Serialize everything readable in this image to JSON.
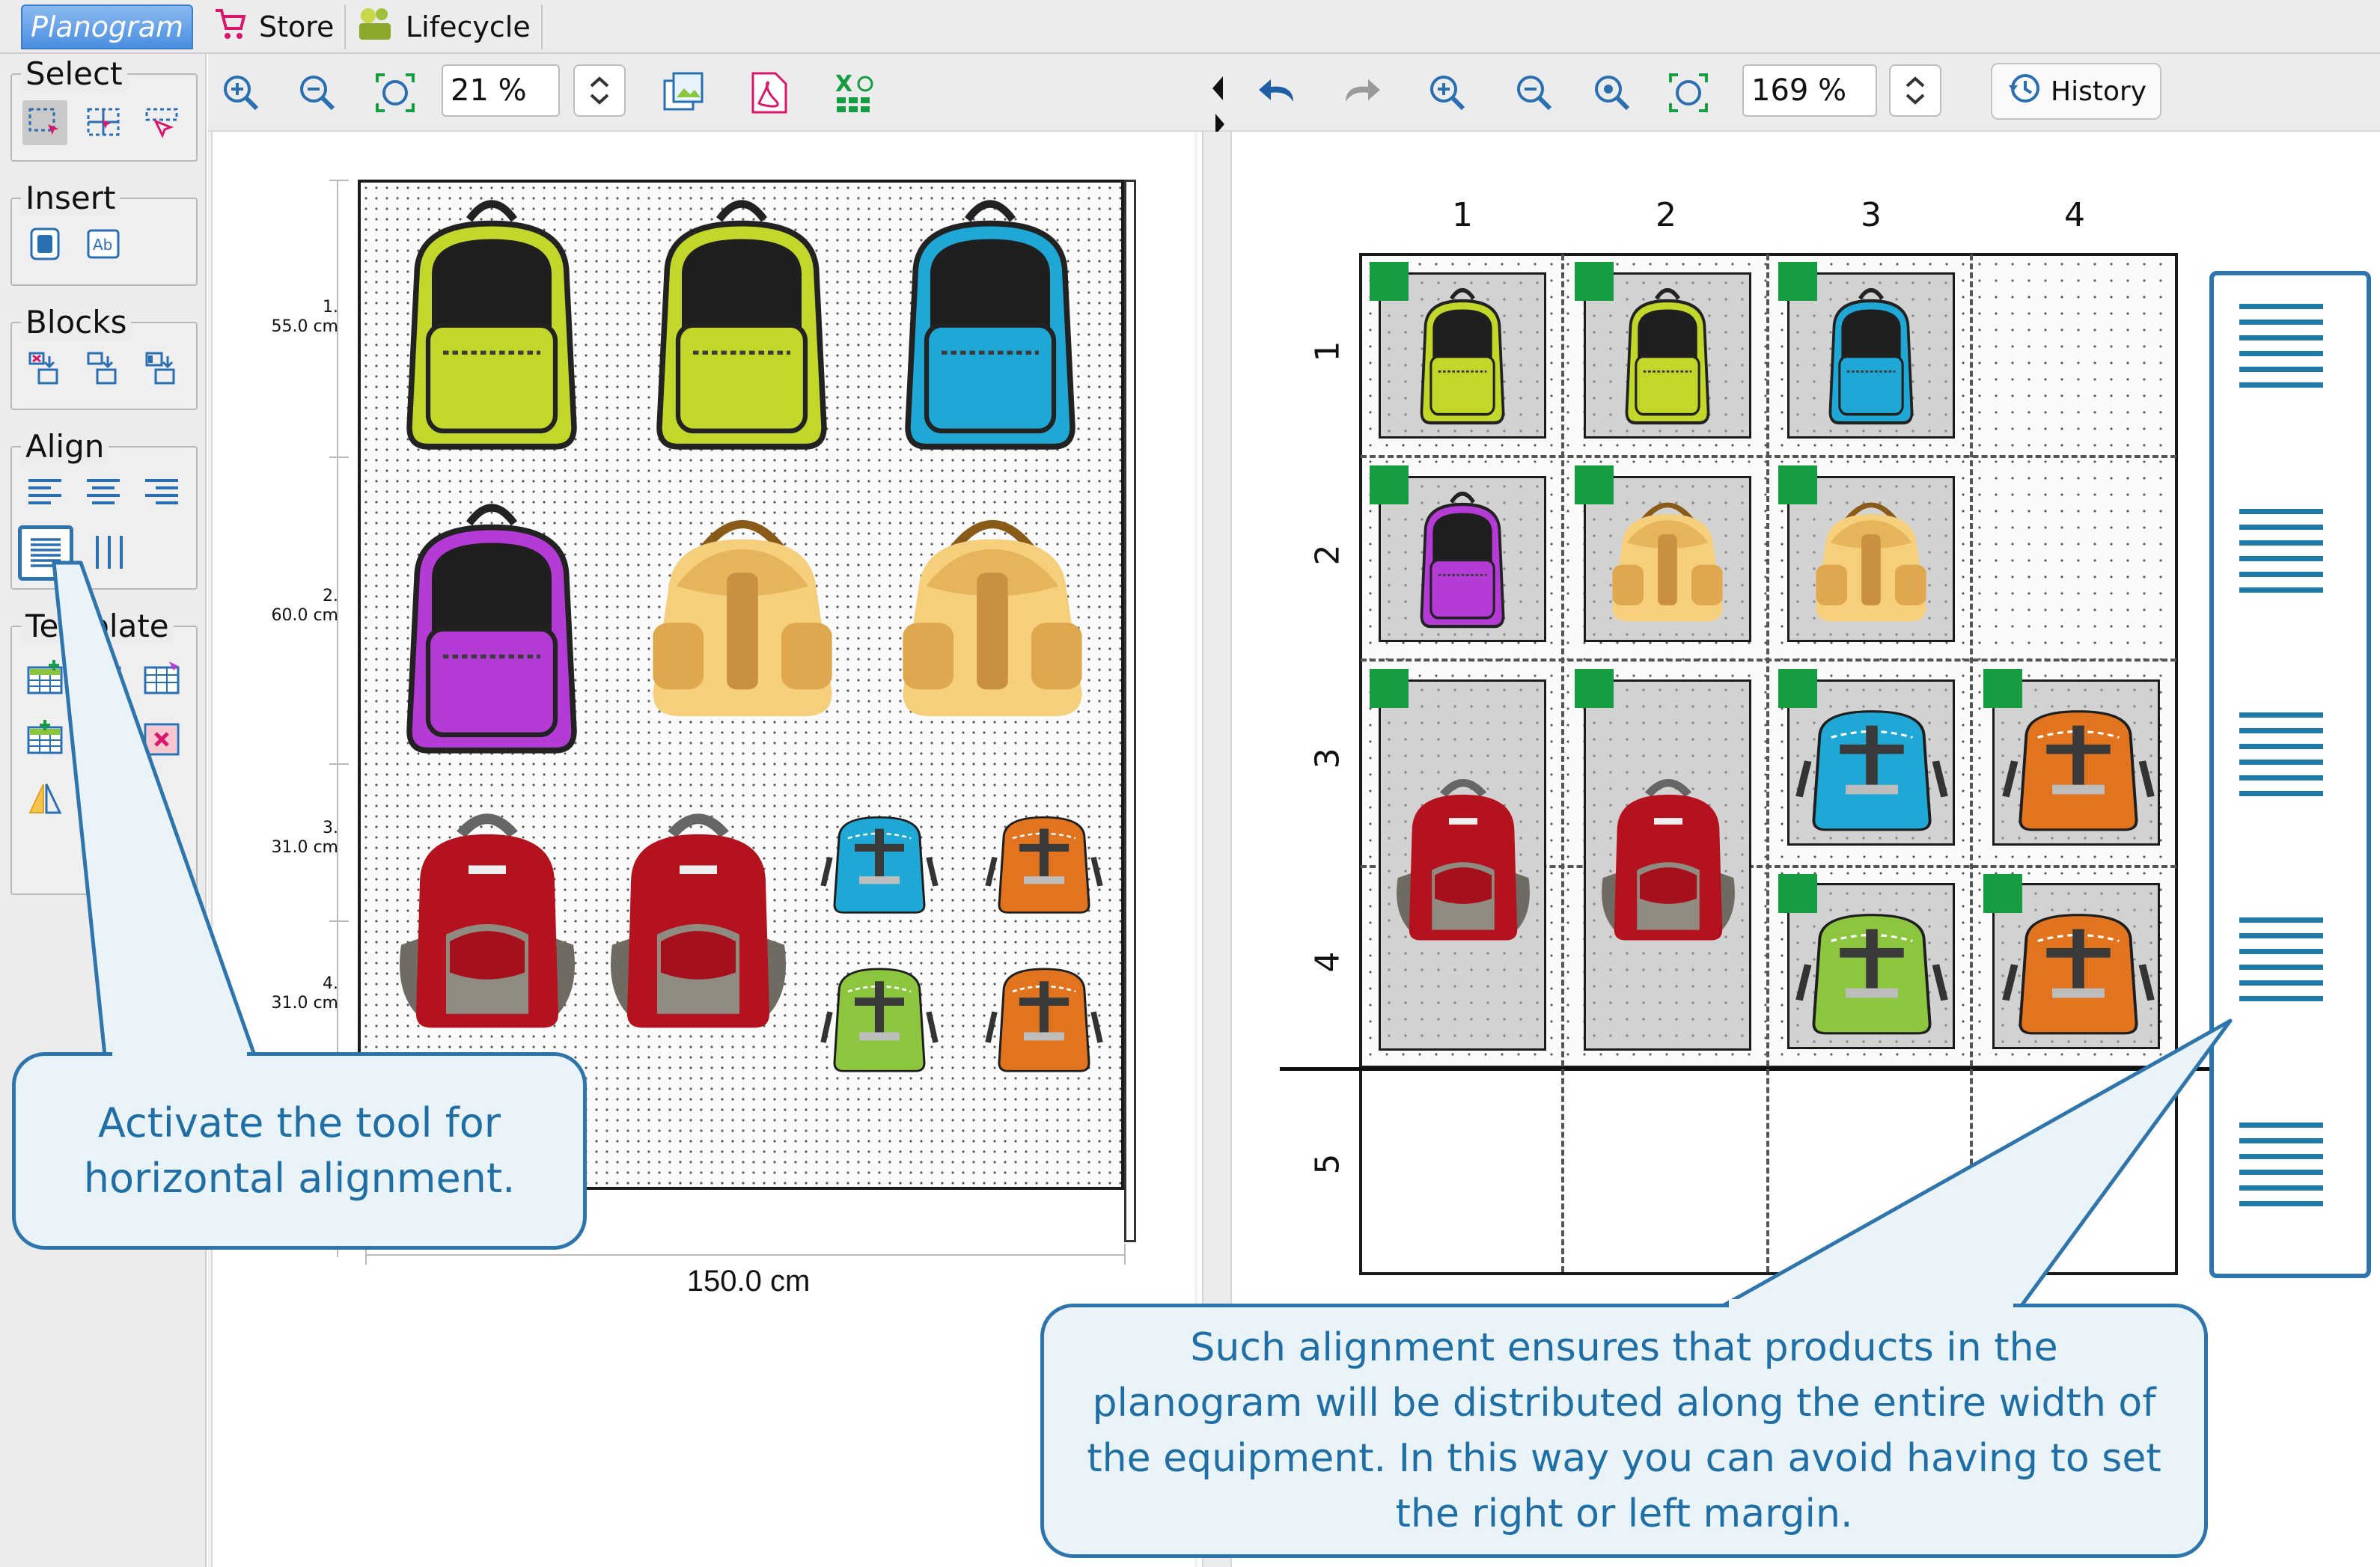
{
  "tabs": [
    {
      "label": "Planogram",
      "active": true
    },
    {
      "label": "Store",
      "icon": "cart-icon"
    },
    {
      "label": "Lifecycle",
      "icon": "lifecycle-icon"
    }
  ],
  "left_panel": {
    "groups": [
      {
        "title": "Select",
        "tools": [
          "select-rectangle-icon",
          "select-grid-icon",
          "select-pointer-icon"
        ]
      },
      {
        "title": "Insert",
        "tools": [
          "insert-product-icon",
          "insert-text-icon"
        ]
      },
      {
        "title": "Blocks",
        "tools": [
          "block-add-icon",
          "block-split-icon",
          "block-merge-icon"
        ]
      },
      {
        "title": "Align",
        "tools": [
          "align-left-icon",
          "align-center-icon",
          "align-right-icon",
          "align-horizontal-distribute-icon",
          "align-vertical-distribute-icon"
        ],
        "active_tool": "align-horizontal-distribute-icon"
      },
      {
        "title": "Template",
        "tools": [
          "template-add-icon",
          "template-remove-icon",
          "template-edit-icon",
          "template-grid-add-icon",
          "template-grid-remove-icon",
          "template-mirror-icon"
        ]
      }
    ]
  },
  "left_toolbar": {
    "zoom_value": "21 %",
    "icons": [
      "zoom-in-icon",
      "zoom-out-icon",
      "fit-icon",
      "image-export-icon",
      "pdf-export-icon",
      "excel-export-icon"
    ]
  },
  "right_toolbar": {
    "zoom_value": "169 %",
    "history_label": "History",
    "icons": [
      "undo-icon",
      "redo-icon",
      "zoom-in-icon",
      "zoom-out-icon",
      "zoom-reset-icon",
      "fit-icon"
    ]
  },
  "left_view": {
    "shelf_labels": [
      {
        "index": "1.",
        "size": "55.0 cm"
      },
      {
        "index": "2.",
        "size": "60.0 cm"
      },
      {
        "index": "3.",
        "size": "31.0 cm"
      },
      {
        "index": "4.",
        "size": "31.0 cm"
      }
    ],
    "width_label": "150.0 cm"
  },
  "right_view": {
    "columns": [
      "1",
      "2",
      "3",
      "4"
    ],
    "rows": [
      "1",
      "2",
      "3",
      "4",
      "5"
    ]
  },
  "callouts": {
    "left": "Activate the tool for horizontal alignment.",
    "right": "Such alignment ensures that products in the planogram will be distributed along the entire width of the equipment. In this way you can avoid having to set the right or left margin."
  },
  "colors": {
    "accent": "#2e75ad",
    "callout_bg": "#eaf4f8",
    "cell_marker": "#169c41",
    "lime": "#c3d62a",
    "cyan": "#1fa8d6",
    "purple": "#b43bd6",
    "tan": "#f5cf7c",
    "red": "#b4121e",
    "orange": "#e2741f",
    "green_bag": "#8cc63f"
  }
}
